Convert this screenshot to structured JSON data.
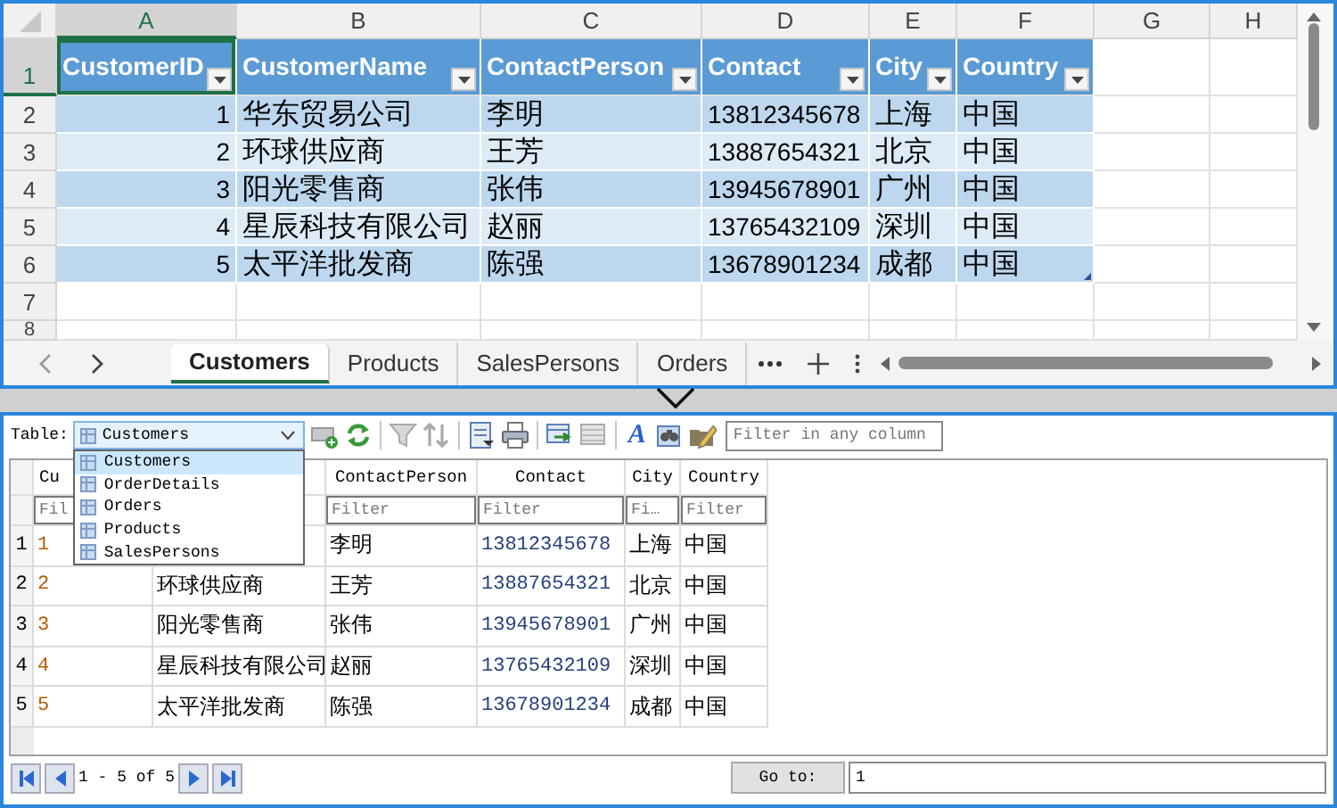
{
  "spreadsheet": {
    "column_letters": [
      {
        "label": "A",
        "selected": true
      },
      {
        "label": "B",
        "selected": false
      },
      {
        "label": "C",
        "selected": false
      },
      {
        "label": "D",
        "selected": false
      },
      {
        "label": "E",
        "selected": false
      },
      {
        "label": "F",
        "selected": false
      },
      {
        "label": "G",
        "selected": false
      },
      {
        "label": "H",
        "selected": false
      }
    ],
    "row_numbers": [
      {
        "label": "1",
        "selected": true
      },
      {
        "label": "2",
        "selected": false
      },
      {
        "label": "3",
        "selected": false
      },
      {
        "label": "4",
        "selected": false
      },
      {
        "label": "5",
        "selected": false
      },
      {
        "label": "6",
        "selected": false
      },
      {
        "label": "7",
        "selected": false
      },
      {
        "label": "8",
        "selected": false
      }
    ],
    "table": {
      "columns": [
        {
          "label": "CustomerID",
          "kind": "number",
          "selected": true
        },
        {
          "label": "CustomerName",
          "kind": "text",
          "selected": false
        },
        {
          "label": "ContactPerson",
          "kind": "text",
          "selected": false
        },
        {
          "label": "Contact",
          "kind": "text",
          "selected": false
        },
        {
          "label": "City",
          "kind": "text",
          "selected": false
        },
        {
          "label": "Country",
          "kind": "text",
          "selected": false
        }
      ],
      "rows": [
        [
          "1",
          "华东贸易公司",
          "李明",
          "13812345678",
          "上海",
          "中国"
        ],
        [
          "2",
          "环球供应商",
          "王芳",
          "13887654321",
          "北京",
          "中国"
        ],
        [
          "3",
          "阳光零售商",
          "张伟",
          "13945678901",
          "广州",
          "中国"
        ],
        [
          "4",
          "星辰科技有限公司",
          "赵丽",
          "13765432109",
          "深圳",
          "中国"
        ],
        [
          "5",
          "太平洋批发商",
          "陈强",
          "13678901234",
          "成都",
          "中国"
        ]
      ]
    },
    "sheet_tabs": [
      {
        "label": "Customers",
        "selected": true
      },
      {
        "label": "Products",
        "selected": false
      },
      {
        "label": "SalesPersons",
        "selected": false
      },
      {
        "label": "Orders",
        "selected": false
      }
    ]
  },
  "viewer": {
    "toolbar": {
      "table_label": "Table:",
      "table_select": {
        "value": "Customers",
        "expanded": true,
        "options": [
          {
            "label": "Customers",
            "selected": true
          },
          {
            "label": "OrderDetails",
            "selected": false
          },
          {
            "label": "Orders",
            "selected": false
          },
          {
            "label": "Products",
            "selected": false
          },
          {
            "label": "SalesPersons",
            "selected": false
          }
        ]
      },
      "style_button": "A",
      "filter": {
        "placeholder": "Filter in any column"
      }
    },
    "grid": {
      "columns": [
        {
          "header": "Cu",
          "filter_placeholder": "Fil",
          "kind": "id"
        },
        {
          "kind": "text"
        },
        {
          "header": "ContactPerson",
          "filter_placeholder": "Filter",
          "kind": "text"
        },
        {
          "header": "Contact",
          "filter_placeholder": "Filter",
          "kind": "phone"
        },
        {
          "header": "City",
          "filter_placeholder": "Fi…",
          "kind": "text"
        },
        {
          "header": "Country",
          "filter_placeholder": "Filter",
          "kind": "text"
        }
      ],
      "rows": [
        {
          "number": "1",
          "cells": [
            "1",
            null,
            "李明",
            "13812345678",
            "上海",
            "中国"
          ]
        },
        {
          "number": "2",
          "cells": [
            "2",
            "环球供应商",
            "王芳",
            "13887654321",
            "北京",
            "中国"
          ]
        },
        {
          "number": "3",
          "cells": [
            "3",
            "阳光零售商",
            "张伟",
            "13945678901",
            "广州",
            "中国"
          ]
        },
        {
          "number": "4",
          "cells": [
            "4",
            "星辰科技有限公司",
            "赵丽",
            "13765432109",
            "深圳",
            "中国"
          ]
        },
        {
          "number": "5",
          "cells": [
            "5",
            "太平洋批发商",
            "陈强",
            "13678901234",
            "成都",
            "中国"
          ]
        }
      ]
    },
    "pager": {
      "range": "1 - 5 of 5",
      "goto_button": "Go to:",
      "goto_value": "1"
    }
  }
}
